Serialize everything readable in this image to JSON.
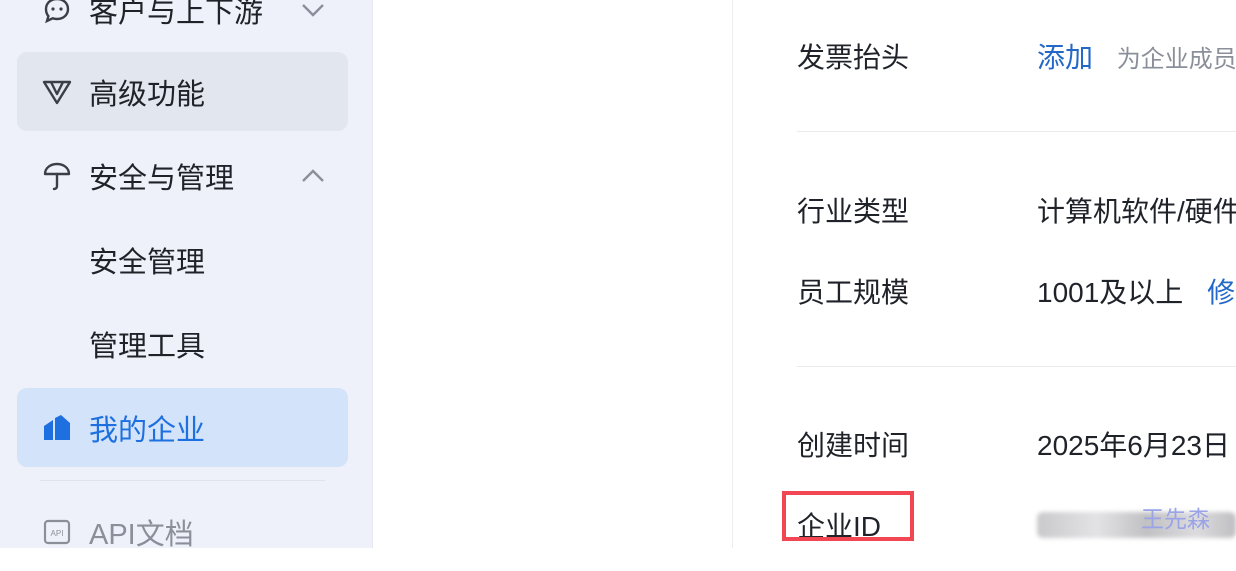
{
  "sidebar": {
    "items": [
      {
        "label": "客户与上下游",
        "icon": "chat-bubble-icon",
        "chevron": "chevron-down"
      },
      {
        "label": "高级功能",
        "icon": "v-logo-icon"
      },
      {
        "label": "安全与管理",
        "icon": "umbrella-icon",
        "chevron": "chevron-up"
      },
      {
        "label": "安全管理"
      },
      {
        "label": "管理工具"
      },
      {
        "label": "我的企业",
        "icon": "building-icon",
        "active": true
      },
      {
        "label": "API文档",
        "icon": "api-doc-icon"
      }
    ]
  },
  "details": {
    "invoice": {
      "label": "发票抬头",
      "action": "添加",
      "hint": "为企业成员i"
    },
    "industry": {
      "label": "行业类型",
      "value": "计算机软件/硬件"
    },
    "scale": {
      "label": "员工规模",
      "value": "1001及以上",
      "action": "修i"
    },
    "created": {
      "label": "创建时间",
      "value": "2025年6月23日"
    },
    "corp_id": {
      "label": "企业ID",
      "watermark": "王先森"
    }
  },
  "colors": {
    "accent": "#1e6fe0",
    "link": "#2468c7",
    "highlight": "#f24652",
    "sidebar_bg": "#eef1f9"
  }
}
